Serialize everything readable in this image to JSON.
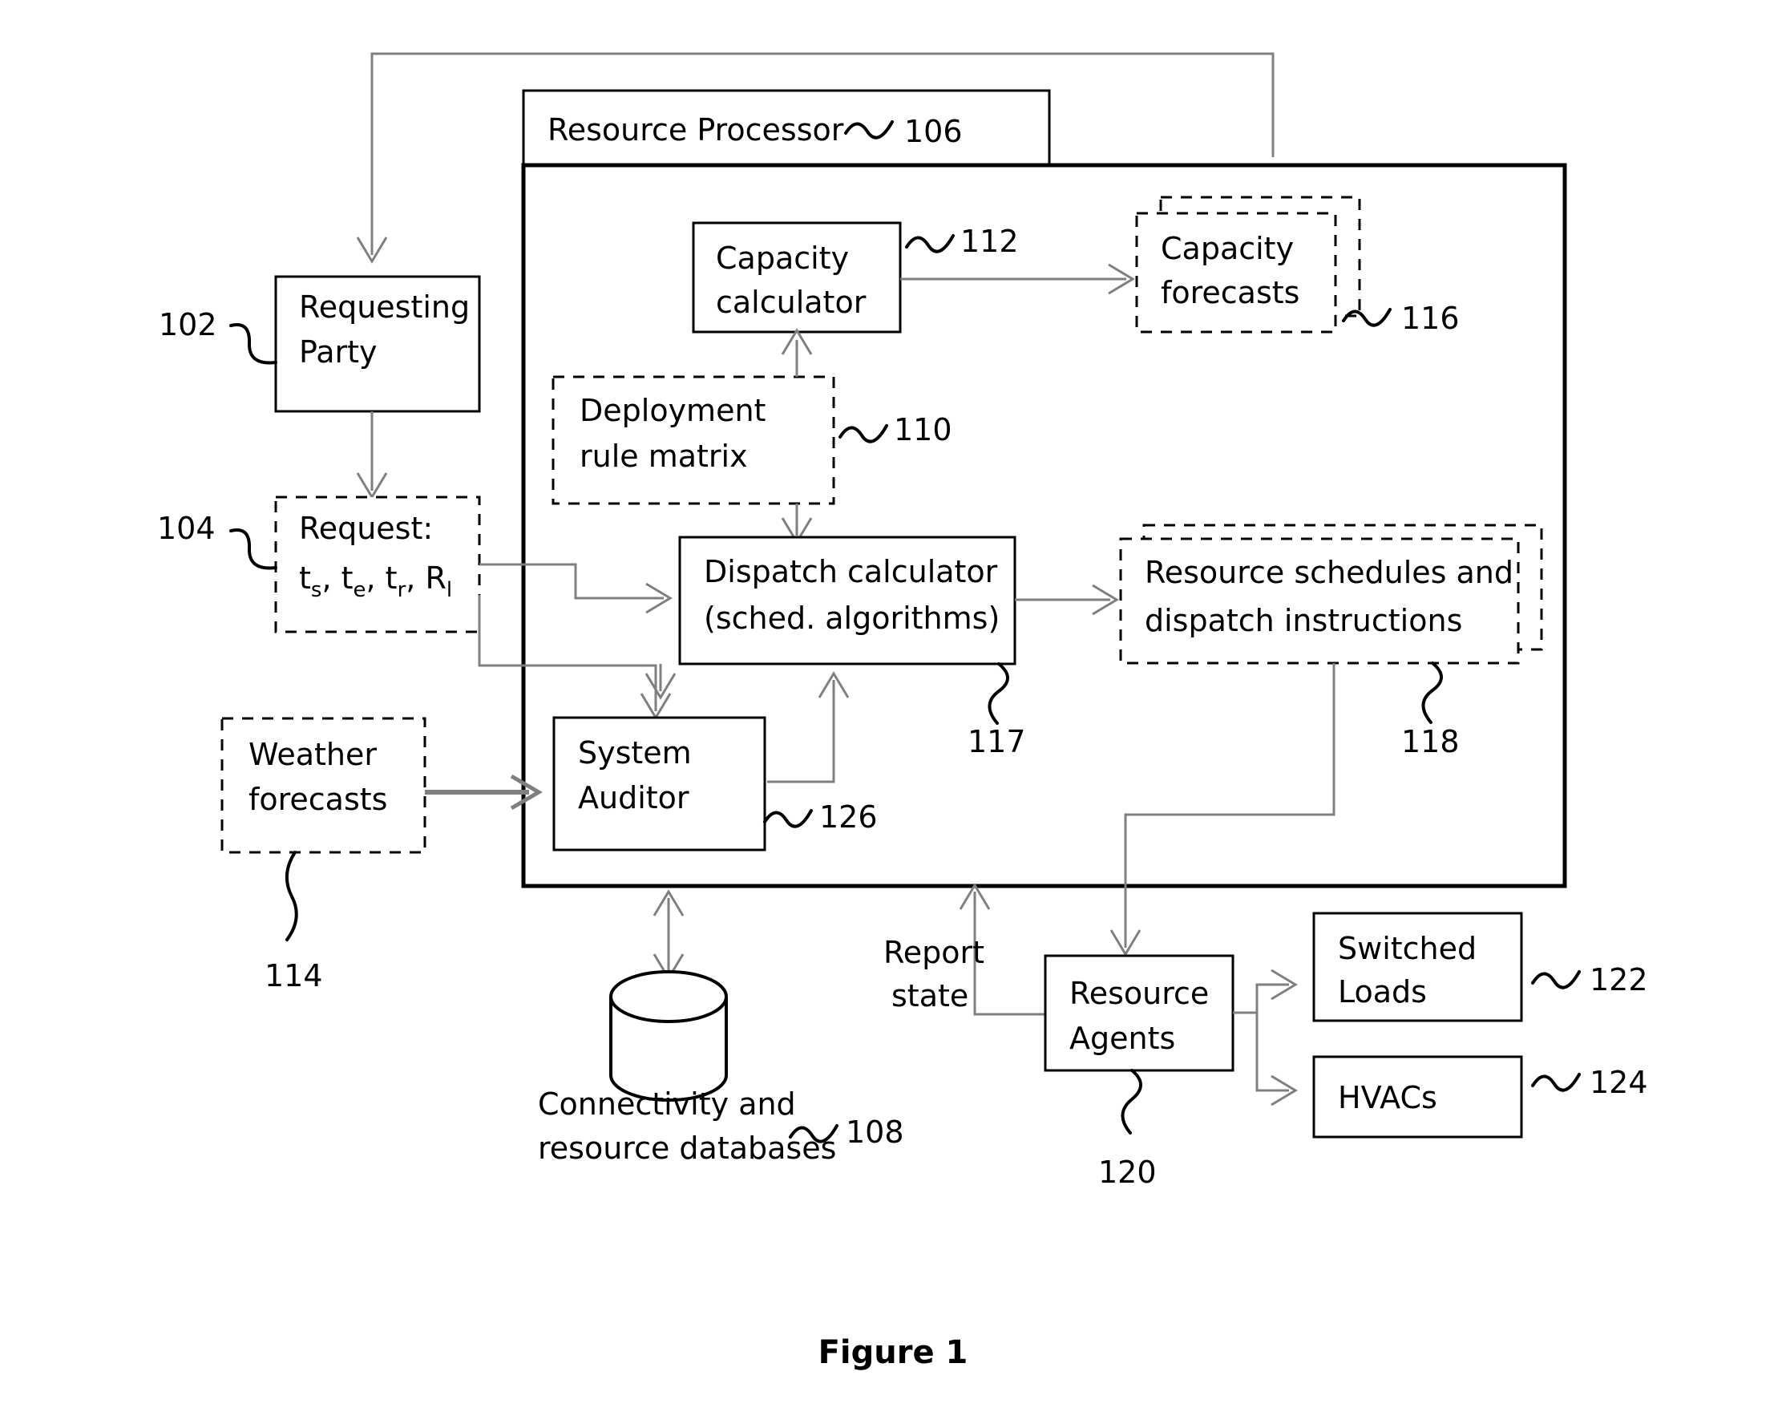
{
  "figure": {
    "caption": "Figure 1"
  },
  "container": {
    "title": "Resource Processor",
    "ref": "106"
  },
  "nodes": {
    "requesting_party": {
      "line1": "Requesting",
      "line2": "Party",
      "ref": "102",
      "style": "solid"
    },
    "request": {
      "line1": "Request:",
      "line2_parts": [
        "t",
        "s",
        ", t",
        "e",
        ", t",
        "r",
        ", R",
        "l"
      ],
      "line2": "ts, te, tr, Rl",
      "ref": "104",
      "style": "dashed"
    },
    "weather_forecasts": {
      "line1": "Weather",
      "line2": "forecasts",
      "ref": "114",
      "style": "dashed"
    },
    "capacity_calculator": {
      "line1": "Capacity",
      "line2": "calculator",
      "ref": "112",
      "style": "solid"
    },
    "capacity_forecasts": {
      "line1": "Capacity",
      "line2": "forecasts",
      "ref": "116",
      "style": "dashed-stacked"
    },
    "deployment_rule_matrix": {
      "line1": "Deployment",
      "line2": "rule matrix",
      "ref": "110",
      "style": "dashed"
    },
    "dispatch_calculator": {
      "line1": "Dispatch calculator",
      "line2": "(sched. algorithms)",
      "ref": "117",
      "style": "solid"
    },
    "resource_schedules": {
      "line1": "Resource schedules and",
      "line2": "dispatch instructions",
      "ref": "118",
      "style": "dashed-stacked"
    },
    "system_auditor": {
      "line1": "System",
      "line2": "Auditor",
      "ref": "126",
      "style": "solid"
    },
    "databases": {
      "caption_line1": "Connectivity and",
      "caption_line2": "resource databases",
      "ref": "108",
      "style": "cylinder"
    },
    "resource_agents": {
      "line1": "Resource",
      "line2": "Agents",
      "ref": "120",
      "style": "solid"
    },
    "switched_loads": {
      "line1": "Switched",
      "line2": "Loads",
      "ref": "122",
      "style": "solid"
    },
    "hvacs": {
      "line1": "HVACs",
      "line2": "",
      "ref": "124",
      "style": "solid"
    }
  },
  "edge_labels": {
    "report_state_line1": "Report",
    "report_state_line2": "state"
  },
  "colors": {
    "stroke": "#000000",
    "connector": "#7f7f7f",
    "background": "#ffffff"
  }
}
